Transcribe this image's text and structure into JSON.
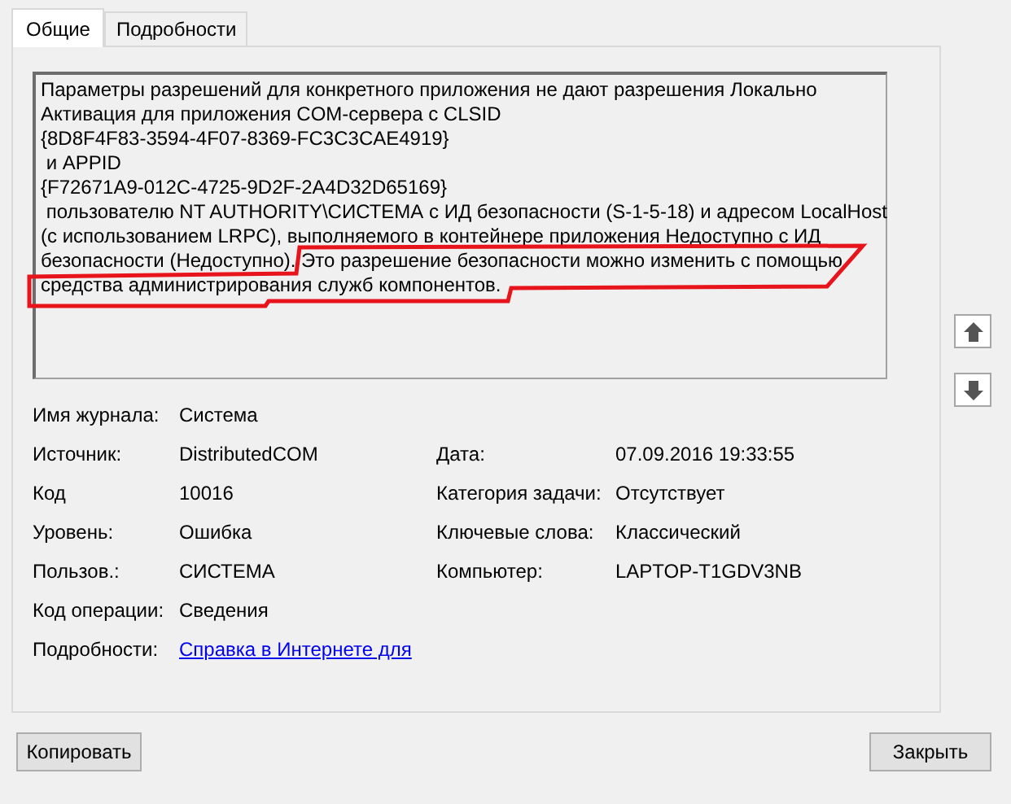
{
  "tabs": [
    {
      "label": "Общие",
      "selected": true
    },
    {
      "label": "Подробности",
      "selected": false
    }
  ],
  "message": {
    "lines": [
      "Параметры разрешений для конкретного приложения не дают разрешения Локально",
      "Активация для приложения COM-сервера с CLSID",
      "{8D8F4F83-3594-4F07-8369-FC3C3CAE4919}",
      " и APPID",
      "{F72671A9-012C-4725-9D2F-2A4D32D65169}",
      " пользователю NT AUTHORITY\\СИСТЕМА с ИД безопасности (S-1-5-18) и адресом LocalHost",
      "(с использованием LRPC), выполняемого в контейнере приложения Недоступно с ИД",
      "безопасности (Недоступно). Это разрешение безопасности можно изменить с помощью",
      "средства администрирования служб компонентов."
    ]
  },
  "fields": [
    {
      "label": "Имя журнала:",
      "value": "Система"
    },
    {
      "label": "Источник:",
      "value": "DistributedCOM",
      "label2": "Дата:",
      "value2": "07.09.2016 19:33:55"
    },
    {
      "label": "Код",
      "value": "10016",
      "label2": "Категория задачи:",
      "value2": "Отсутствует"
    },
    {
      "label": "Уровень:",
      "value": "Ошибка",
      "label2": "Ключевые слова:",
      "value2": "Классический"
    },
    {
      "label": "Пользов.:",
      "value": "СИСТЕМА",
      "label2": "Компьютер:",
      "value2": "LAPTOP-T1GDV3NB"
    },
    {
      "label": "Код операции:",
      "value": "Сведения"
    },
    {
      "label": "Подробности:",
      "value": "Справка в Интернете для",
      "kind": "link"
    }
  ],
  "buttons": [
    {
      "label": "Копировать"
    },
    {
      "label": "Закрыть"
    }
  ]
}
